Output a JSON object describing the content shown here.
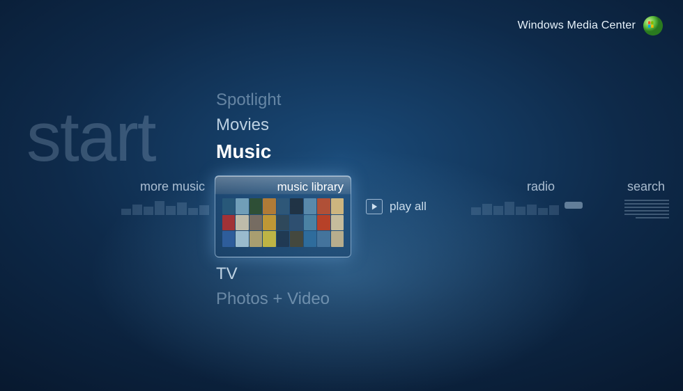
{
  "header": {
    "title": "Windows Media Center"
  },
  "start_label": "start",
  "categories": {
    "above": [
      {
        "key": "spotlight",
        "label": "Spotlight"
      },
      {
        "key": "movies",
        "label": "Movies"
      }
    ],
    "active": {
      "key": "music",
      "label": "Music"
    },
    "below": [
      {
        "key": "tv",
        "label": "TV"
      },
      {
        "key": "photosvideo",
        "label": "Photos + Video"
      }
    ]
  },
  "music_row": {
    "more_music": {
      "label": "more music"
    },
    "library": {
      "label": "music library"
    },
    "play_all": {
      "label": "play all"
    },
    "radio": {
      "label": "radio"
    },
    "search": {
      "label": "search"
    }
  },
  "thumb_colors": [
    "#2a5a7a",
    "#7aa8c0",
    "#305030",
    "#c08030",
    "#305878",
    "#203040",
    "#6090b0",
    "#c05030",
    "#e0c080",
    "#b03030",
    "#d0c8b0",
    "#807060",
    "#d0a030",
    "#304858",
    "#305070",
    "#5088a8",
    "#c84020",
    "#d8c8a0",
    "#3060a0",
    "#a8c8d8",
    "#b8a870",
    "#d0c040",
    "#203850",
    "#484838",
    "#3070a0",
    "#4878a0",
    "#c8b890"
  ]
}
